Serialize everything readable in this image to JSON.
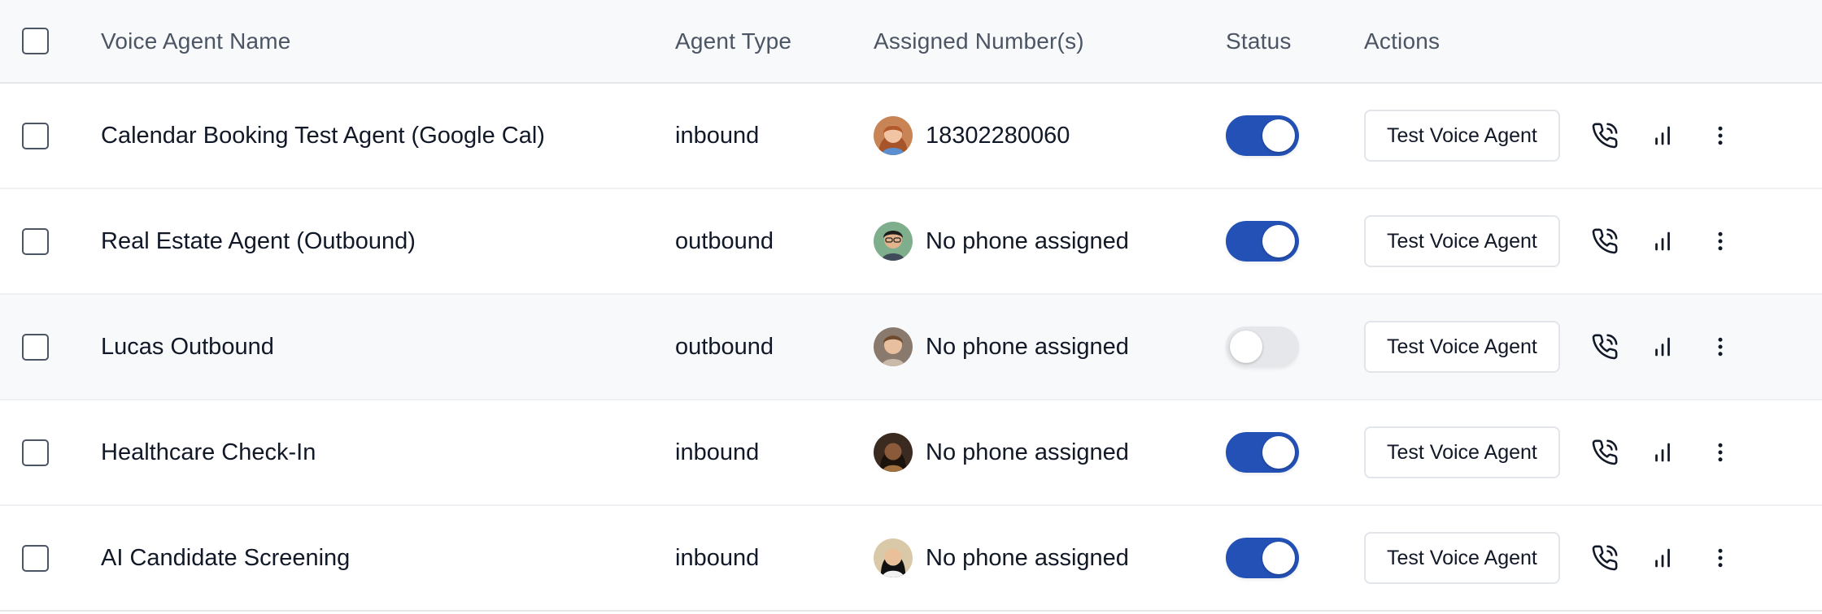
{
  "columns": {
    "name": "Voice Agent Name",
    "type": "Agent Type",
    "numbers": "Assigned Number(s)",
    "status": "Status",
    "actions": "Actions"
  },
  "rows": [
    {
      "name": "Calendar Booking Test Agent (Google Cal)",
      "type": "inbound",
      "number": "18302280060",
      "status_enabled": true,
      "test_label": "Test Voice Agent",
      "avatar": "woman-red-hair"
    },
    {
      "name": "Real Estate Agent (Outbound)",
      "type": "outbound",
      "number": "No phone assigned",
      "status_enabled": true,
      "test_label": "Test Voice Agent",
      "avatar": "man-glasses"
    },
    {
      "name": "Lucas Outbound",
      "type": "outbound",
      "number": "No phone assigned",
      "status_enabled": false,
      "test_label": "Test Voice Agent",
      "avatar": "man-brown-hair"
    },
    {
      "name": "Healthcare Check-In",
      "type": "inbound",
      "number": "No phone assigned",
      "status_enabled": true,
      "test_label": "Test Voice Agent",
      "avatar": "woman-dark-hair"
    },
    {
      "name": "AI Candidate Screening",
      "type": "inbound",
      "number": "No phone assigned",
      "status_enabled": true,
      "test_label": "Test Voice Agent",
      "avatar": "woman-black-hair"
    }
  ],
  "colors": {
    "toggle_on": "#2451b5",
    "toggle_off": "#e5e7eb",
    "header_bg": "#f8f9fb"
  }
}
